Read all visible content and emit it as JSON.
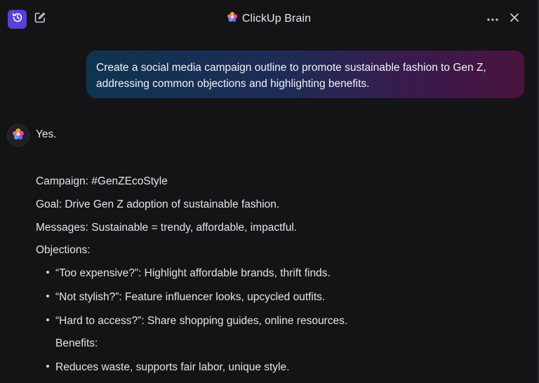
{
  "header": {
    "title": "ClickUp Brain",
    "icons": {
      "history": "history-icon",
      "edit": "edit-icon",
      "brand": "clickup-brain-logo-icon",
      "more": "more-horizontal-icon",
      "close": "close-icon"
    }
  },
  "user_message": {
    "text": "Create a social media campaign outline to promote sustainable fashion to Gen Z, addressing common objections and highlighting benefits."
  },
  "assistant": {
    "avatar": "clickup-brain-logo-icon",
    "intro": "Yes.",
    "campaign": "Campaign: #GenZEcoStyle",
    "goal": "Goal: Drive Gen Z adoption of sustainable fashion.",
    "messages": "Messages: Sustainable = trendy, affordable, impactful.",
    "objections_heading": "Objections:",
    "objections": [
      "“Too expensive?”: Highlight affordable brands, thrift finds.",
      "“Not stylish?”: Feature influencer looks, upcycled outfits.",
      "“Hard to access?”: Share shopping guides, online resources."
    ],
    "benefits_heading": "Benefits:",
    "benefits": [
      "Reduces waste, supports fair labor, unique style."
    ]
  },
  "colors": {
    "background": "#141417",
    "accent": "#5b3fd6",
    "bubble_start": "#0f3450",
    "bubble_end": "#4a143f"
  }
}
